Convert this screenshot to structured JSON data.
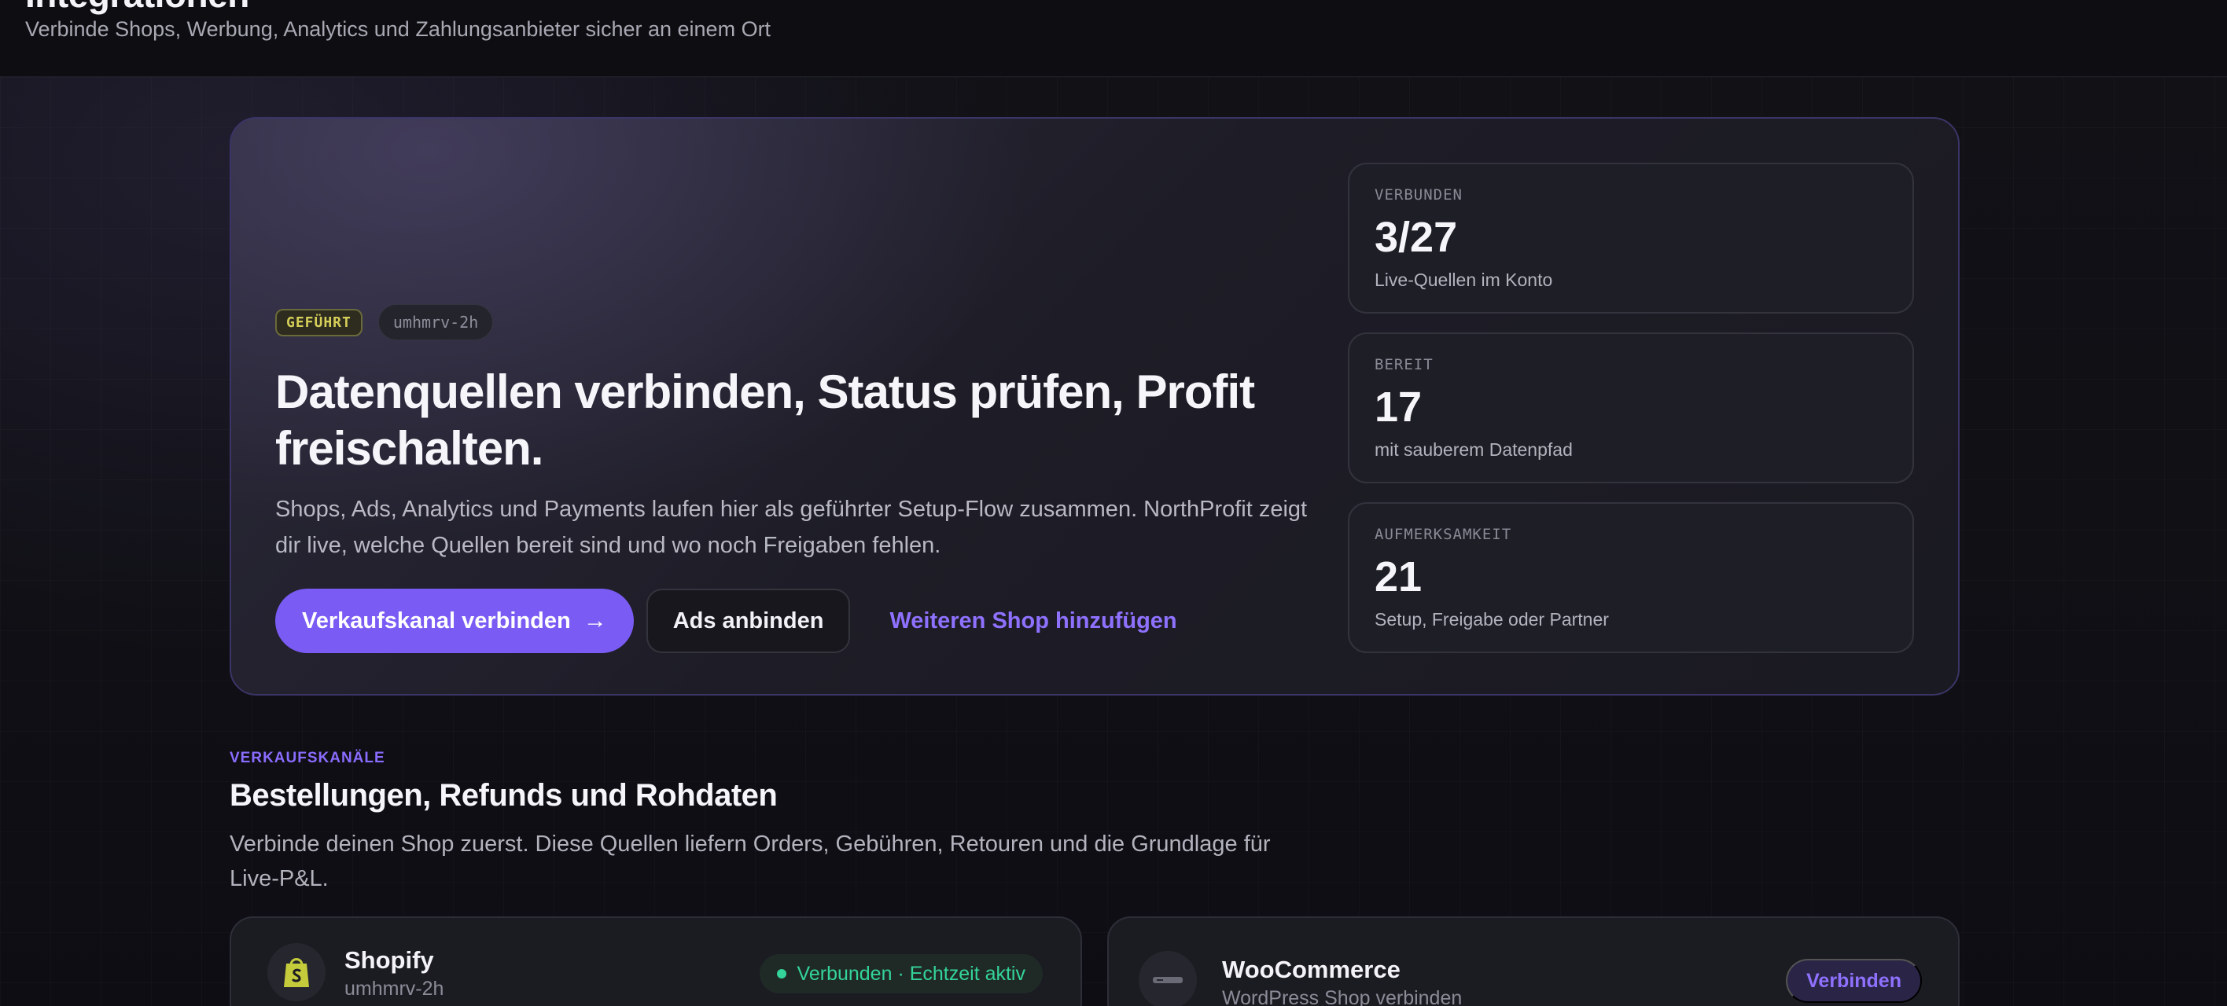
{
  "header": {
    "title": "Integrationen",
    "subtitle": "Verbinde Shops, Werbung, Analytics und Zahlungsanbieter sicher an einem Ort"
  },
  "hero": {
    "badge_guided": "GEFÜHRT",
    "badge_id": "umhmrv-2h",
    "title": "Datenquellen verbinden, Status prüfen, Profit freischalten.",
    "description": "Shops, Ads, Analytics und Payments laufen hier als geführter Setup-Flow zusammen. NorthProfit zeigt dir live, welche Quellen bereit sind und wo noch Freigaben fehlen.",
    "primary_button": "Verkaufskanal verbinden",
    "secondary_button": "Ads anbinden",
    "link_button": "Weiteren Shop hinzufügen"
  },
  "stats": [
    {
      "label": "VERBUNDEN",
      "value": "3/27",
      "desc": "Live-Quellen im Konto"
    },
    {
      "label": "BEREIT",
      "value": "17",
      "desc": "mit sauberem Datenpfad"
    },
    {
      "label": "AUFMERKSAMKEIT",
      "value": "21",
      "desc": "Setup, Freigabe oder Partner"
    }
  ],
  "section": {
    "eyebrow": "VERKAUFSKANÄLE",
    "title": "Bestellungen, Refunds und Rohdaten",
    "description": "Verbinde deinen Shop zuerst. Diese Quellen liefern Orders, Gebühren, Retouren und die Grundlage für Live-P&L."
  },
  "providers": [
    {
      "name": "Shopify",
      "subtitle": "umhmrv-2h",
      "status": "Verbunden · Echtzeit aktiv",
      "icon": "shopify-bag-icon"
    },
    {
      "name": "WooCommerce",
      "subtitle": "WordPress Shop verbinden",
      "action": "Verbinden",
      "icon": "woocommerce-icon"
    }
  ],
  "colors": {
    "accent": "#7a5cf5",
    "link": "#8f71ff",
    "success": "#34d399",
    "badge_guided": "#d6cf5a"
  }
}
